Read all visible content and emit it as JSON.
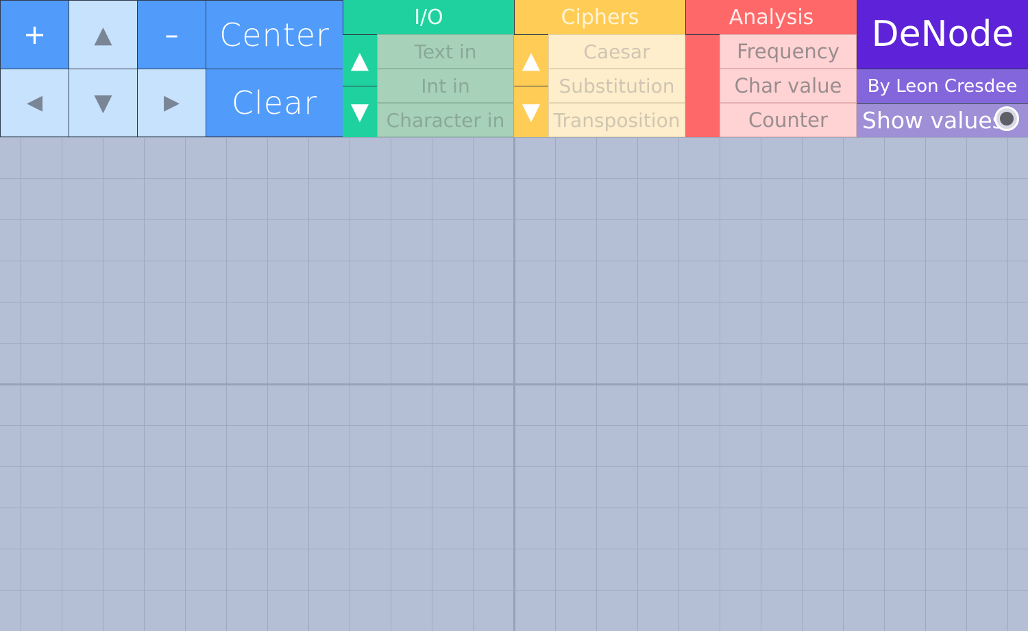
{
  "app": {
    "title": "DeNode",
    "byline": "By Leon Cresdee"
  },
  "nav": {
    "zoom_in": "+",
    "pan_up": "▲",
    "zoom_out": "–",
    "center_label": "Center",
    "pan_left": "◀",
    "pan_down": "▼",
    "pan_right": "▶",
    "clear_label": "Clear"
  },
  "categories": {
    "io": {
      "label": "I/O",
      "scroll_up": "▲",
      "scroll_down": "▼",
      "items": [
        "Text in",
        "Int in",
        "Character in"
      ]
    },
    "ciphers": {
      "label": "Ciphers",
      "scroll_up": "▲",
      "scroll_down": "▼",
      "items": [
        "Caesar",
        "Substitution",
        "Transposition"
      ]
    },
    "analysis": {
      "label": "Analysis",
      "items": [
        "Frequency",
        "Char value",
        "Counter"
      ]
    }
  },
  "options": {
    "show_values_label": "Show values",
    "show_values_enabled": true
  },
  "colors": {
    "nav_blue": "#519cfb",
    "nav_light": "#c7e2fd",
    "io_green": "#1fd19e",
    "ciphers_yellow": "#ffcc55",
    "analysis_red": "#ff6868",
    "brand_purple": "#5e22d8",
    "canvas_bg": "#b4bed4"
  }
}
